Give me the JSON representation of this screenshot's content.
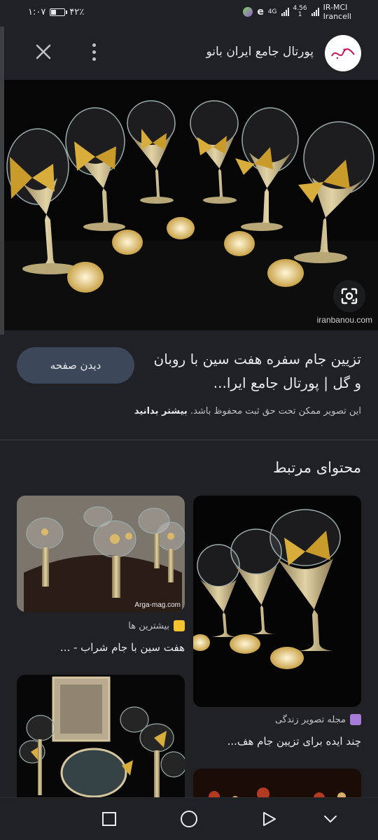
{
  "status_bar": {
    "time": "۱:۰۷",
    "battery": "۴۲٪",
    "battery_level": 0.42,
    "carrier_line1": "IR-MCI",
    "carrier_line2": "Irancell",
    "network_speed_top": "4.56",
    "network_speed_bottom": "1",
    "network_type": "4G"
  },
  "header": {
    "site_title": "پورتال جامع ایران بانو",
    "logo_text": "بانو"
  },
  "hero": {
    "watermark": "iranbanou.com"
  },
  "result": {
    "title": "تزیین جام سفره هفت سین با روبان و گل | پورتال جامع ایرا...",
    "visit_label": "دیدن صفحه",
    "copyright_text": "این تصویر ممکن تحت حق ثبت محفوظ باشد.",
    "learn_more": "بیشتر بدانید"
  },
  "related": {
    "heading": "محتوای مرتبط",
    "cards": [
      {
        "source": "مجله تصویر زندگی",
        "caption": "چند ایده برای تزیین جام هف...",
        "favicon_color": "#a77bd8"
      },
      {
        "source": "بیشترین ها",
        "caption": "هفت سین با جام شراب - ...",
        "favicon_color": "#f4c430",
        "watermark": "Arga-mag.com"
      }
    ]
  },
  "colors": {
    "background": "#202124",
    "button_bg": "#3c4759",
    "text_primary": "#e8eaed",
    "text_secondary": "#bdc1c6"
  }
}
